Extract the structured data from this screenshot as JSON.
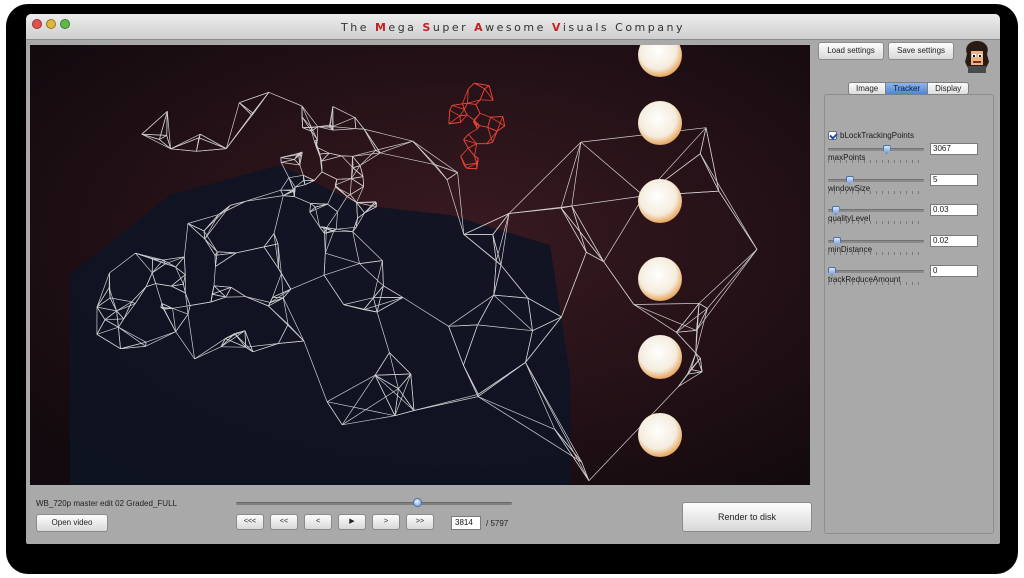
{
  "window": {
    "title_parts": [
      {
        "text": "The ",
        "hl": false
      },
      {
        "text": "M",
        "hl": true
      },
      {
        "text": "ega ",
        "hl": false
      },
      {
        "text": "S",
        "hl": true
      },
      {
        "text": "uper ",
        "hl": false
      },
      {
        "text": "A",
        "hl": true
      },
      {
        "text": "wesome ",
        "hl": false
      },
      {
        "text": "V",
        "hl": true
      },
      {
        "text": "isuals Company",
        "hl": false
      }
    ]
  },
  "video": {
    "filename": "WB_720p master edit 02 Graded_FULL",
    "current_frame": "3814",
    "total_frames": "/ 5797",
    "seek_fraction": 0.66
  },
  "controls": {
    "open_video": "Open video",
    "transport": [
      {
        "name": "first-frame-button",
        "label": "<<<"
      },
      {
        "name": "rewind-button",
        "label": "<<"
      },
      {
        "name": "step-back-button",
        "label": "<"
      },
      {
        "name": "play-button",
        "label": "▶"
      },
      {
        "name": "step-forward-button",
        "label": ">"
      },
      {
        "name": "fast-forward-button",
        "label": ">>"
      }
    ],
    "render": "Render to disk"
  },
  "sidebar": {
    "load_settings": "Load settings",
    "save_settings": "Save settings",
    "tabs": [
      {
        "label": "Image",
        "active": false
      },
      {
        "label": "Tracker",
        "active": true
      },
      {
        "label": "Display",
        "active": false
      }
    ],
    "checkbox_label": "bLockTrackingPoints",
    "checkbox_checked": true,
    "params": [
      {
        "label": "maxPoints",
        "value": "3067",
        "fraction": 0.62
      },
      {
        "label": "windowSize",
        "value": "5",
        "fraction": 0.2
      },
      {
        "label": "qualityLevel",
        "value": "0.03",
        "fraction": 0.04
      },
      {
        "label": "minDistance",
        "value": "0.02",
        "fraction": 0.06
      },
      {
        "label": "trackReduceAmount",
        "value": "0",
        "fraction": 0.0
      }
    ]
  },
  "colors": {
    "accent": "#c42222",
    "mesh_white": "#f2f2f2",
    "mesh_red": "#e0392c"
  }
}
